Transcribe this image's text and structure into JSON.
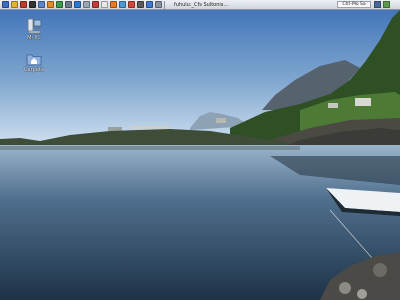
{
  "panel": {
    "task_label": "fuhulu:_Cfs Sultonis...",
    "tray_label": "Ctrl-Mo Sa",
    "launchers": [
      {
        "icon": "start-menu-icon",
        "color": "#3a6fc4"
      },
      {
        "icon": "folder-icon",
        "color": "#e2b33c"
      },
      {
        "icon": "tool-icon",
        "color": "#c0392b"
      },
      {
        "icon": "terminal-icon",
        "color": "#333333"
      },
      {
        "icon": "editor-icon",
        "color": "#5b86c9"
      },
      {
        "icon": "archive-icon",
        "color": "#e08a2a"
      },
      {
        "icon": "photo-icon",
        "color": "#3c9a4b"
      },
      {
        "icon": "settings-icon",
        "color": "#6d7a8f"
      },
      {
        "icon": "network-icon",
        "color": "#2b7bd6"
      },
      {
        "icon": "doc-icon",
        "color": "#9aa6b8"
      },
      {
        "icon": "media-icon",
        "color": "#c43c3c"
      },
      {
        "icon": "mail-icon",
        "color": "#e8e8e8"
      },
      {
        "icon": "browser-icon",
        "color": "#e87a20"
      },
      {
        "icon": "chat-icon",
        "color": "#4a9ad4"
      },
      {
        "icon": "calendar-icon",
        "color": "#d4463c"
      },
      {
        "icon": "help-icon",
        "color": "#5a5a5a"
      },
      {
        "icon": "globe-icon",
        "color": "#3b7ad0"
      },
      {
        "icon": "window-icon",
        "color": "#8a93a3"
      }
    ],
    "tray_icons": [
      {
        "icon": "volume-icon",
        "color": "#4a6a9a"
      },
      {
        "icon": "battery-icon",
        "color": "#5a9a4a"
      }
    ]
  },
  "desktop": {
    "icons": [
      {
        "name": "computer-desktop-icon",
        "label": "Mi PC",
        "glyph": "computer-icon"
      },
      {
        "name": "home-desktop-icon",
        "label": "Carpeta",
        "glyph": "home-folder-icon"
      }
    ]
  },
  "colors": {
    "sky_top": "#3f73b8",
    "sky_bottom": "#cfe0ef",
    "water_dark": "#243b52",
    "water_light": "#8aa7c3",
    "mountain": "#4f5f6e",
    "hill_green": "#3f6a2e"
  }
}
